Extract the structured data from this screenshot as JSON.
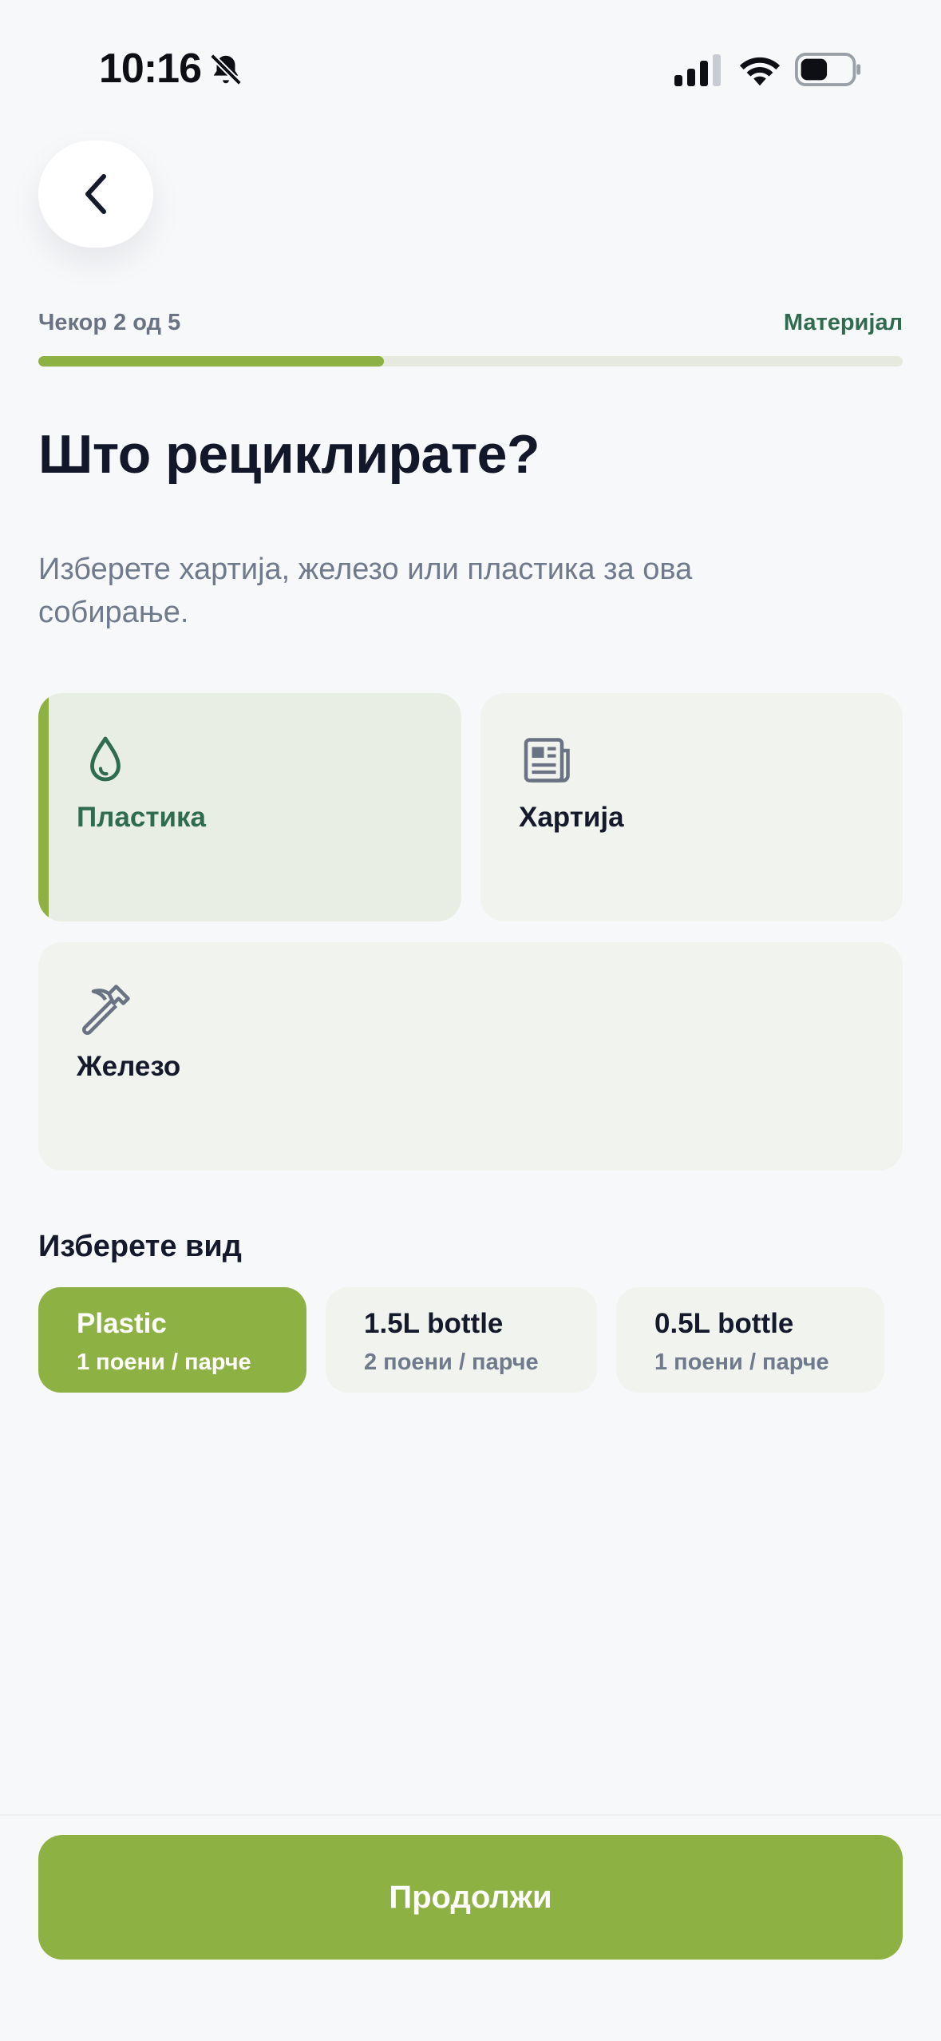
{
  "status_bar": {
    "time": "10:16",
    "icons": [
      "bell-slash-icon",
      "cellular-signal-icon",
      "wifi-icon",
      "battery-icon"
    ]
  },
  "header": {
    "back_icon": "chevron-left-icon"
  },
  "progress": {
    "step_label": "Чекор 2 од 5",
    "step_name": "Материјал",
    "current_step": 2,
    "total_steps": 5,
    "fraction": 0.4
  },
  "title": "Што рециклирате?",
  "subtitle": "Изберете хартија, железо или пластика за ова собирање.",
  "materials": [
    {
      "label": "Пластика",
      "icon": "water-drop-icon",
      "selected": true
    },
    {
      "label": "Хартија",
      "icon": "newspaper-icon",
      "selected": false
    },
    {
      "label": "Железо",
      "icon": "hammer-icon",
      "selected": false
    }
  ],
  "type_section": {
    "title": "Изберете вид",
    "options": [
      {
        "name": "Plastic",
        "points": "1 поени / парче",
        "selected": true
      },
      {
        "name": "1.5L bottle",
        "points": "2 поени / парче",
        "selected": false
      },
      {
        "name": "0.5L bottle",
        "points": "1 поени / парче",
        "selected": false
      }
    ]
  },
  "footer": {
    "continue_label": "Продолжи"
  },
  "colors": {
    "accent": "#8db143",
    "accent_dark": "#2f6b4f",
    "background": "#f7f8fa",
    "card": "#f1f3ef",
    "card_selected": "#e8eee4",
    "text_primary": "#141a2b",
    "text_muted": "#6f7a8c"
  }
}
